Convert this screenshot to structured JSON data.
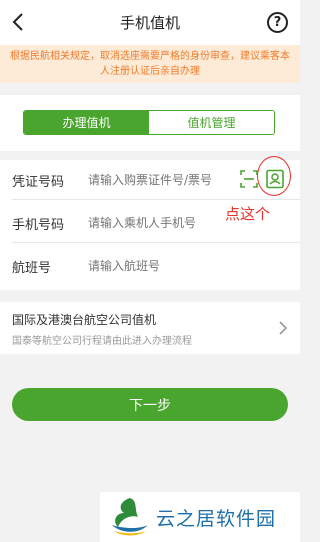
{
  "header": {
    "title": "手机值机",
    "help_symbol": "?"
  },
  "notice": {
    "text": "根据民航相关规定，取消选座需要严格的身份审查，建议乘客本人注册认证后亲自办理"
  },
  "tabs": [
    {
      "label": "办理值机",
      "active": true
    },
    {
      "label": "值机管理",
      "active": false
    }
  ],
  "form": {
    "id_label": "凭证号码",
    "id_placeholder": "请输入购票证件号/票号",
    "phone_label": "手机号码",
    "phone_placeholder": "请输入乘机人手机号",
    "flight_label": "航班号",
    "flight_placeholder": "请输入航班号"
  },
  "annotation": {
    "text": "点这个",
    "color": "#e8322a"
  },
  "international": {
    "title": "国际及港澳台航空公司值机",
    "subtitle": "国泰等航空公司行程请由此进入办理流程"
  },
  "next_button": {
    "label": "下一步"
  },
  "watermark": {
    "text": "云之居软件园"
  },
  "colors": {
    "accent": "#4aa52e",
    "notice_text": "#f07a2a",
    "notice_bg": "#fdebd8"
  }
}
